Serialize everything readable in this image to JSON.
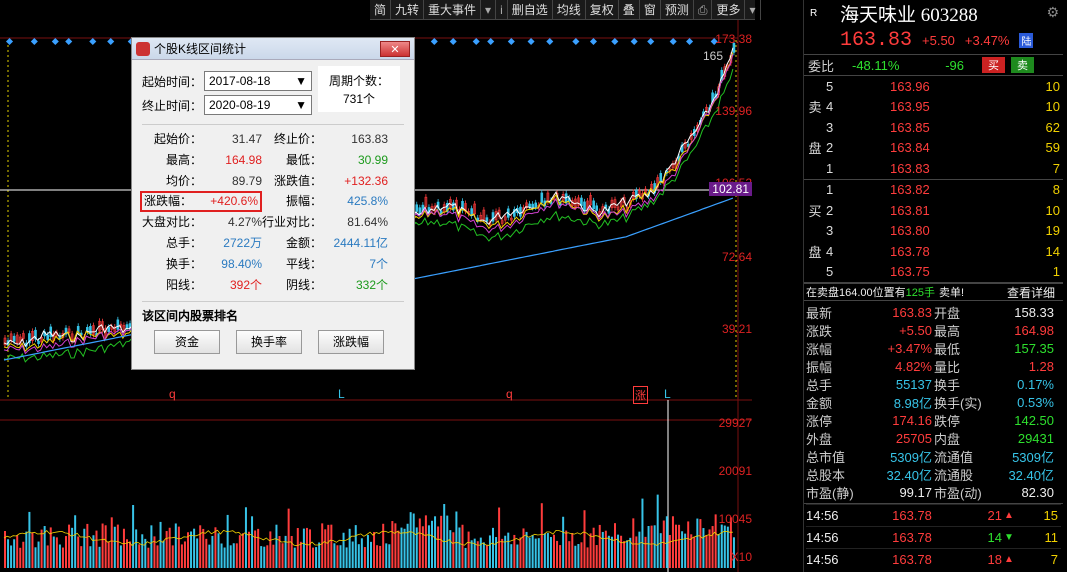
{
  "toolbar": {
    "items": [
      "简",
      "九转",
      "重大事件",
      "▾",
      "i",
      "删自选",
      "均线",
      "复权",
      "叠",
      "窗",
      "预测",
      "⎙",
      "更多",
      "▾"
    ]
  },
  "chart": {
    "price_axis": [
      "173.38",
      "139.96",
      "106.52",
      "72.64",
      "39.21"
    ],
    "current_price_tag": "102.81",
    "peak_label": "165",
    "volume_axis": [
      "29927",
      "20091",
      "10045",
      "X10"
    ],
    "markers": [
      "q",
      "L",
      "q",
      "涨",
      "L"
    ],
    "colors": {
      "up": "#ff3c3c",
      "down": "#37c4e8",
      "ma1": "#ffffff",
      "ma2": "#f0d000",
      "ma3": "#d040d0",
      "ma4": "#22c022",
      "ma5": "#3aa0ff"
    }
  },
  "dialog": {
    "title": "个股K线区间统计",
    "close_label": "✕",
    "start_label": "起始时间：",
    "start_value": "2017-08-18",
    "end_label": "终止时间：",
    "end_value": "2020-08-19",
    "period_label": "周期个数：",
    "period_value": "731个",
    "stats": {
      "start_price_label": "起始价：",
      "start_price": "31.47",
      "end_price_label": "终止价：",
      "end_price": "163.83",
      "high_label": "最高：",
      "high": "164.98",
      "low_label": "最低：",
      "low": "30.99",
      "avg_label": "均价：",
      "avg": "89.79",
      "change_label": "涨跌值：",
      "change": "+132.36",
      "pct_label": "涨跌幅：",
      "pct": "+420.6%",
      "amp_label": "振幅：",
      "amp": "425.8%",
      "mkt_label": "大盘对比：",
      "mkt": "4.27%",
      "ind_label": "行业对比：",
      "ind": "81.64%",
      "vol_label": "总手：",
      "vol": "2722万",
      "amt_label": "金额：",
      "amt": "2444.11亿",
      "turn_label": "换手：",
      "turn": "98.40%",
      "flat_label": "平线：",
      "flat": "7个",
      "yang_label": "阳线：",
      "yang": "392个",
      "yin_label": "阴线：",
      "yin": "332个"
    },
    "rank_title": "该区间内股票排名",
    "rank_buttons": [
      "资金",
      "换手率",
      "涨跌幅"
    ]
  },
  "quote": {
    "r_label": "R",
    "name": "海天味业 603288",
    "price": "163.83",
    "change": "+5.50",
    "pct": "+3.47%",
    "board_tag": "陆",
    "weibi_label": "委比",
    "weibi_pct": "-48.11%",
    "weibi_diff": "-96",
    "buy_btn": "买",
    "sell_btn": "卖",
    "sell_side_chars": [
      "卖",
      "",
      "盘",
      ""
    ],
    "buy_side_chars": [
      "",
      "买",
      "",
      "盘",
      ""
    ],
    "asks": [
      {
        "lvl": "5",
        "px": "163.96",
        "vol": "10"
      },
      {
        "lvl": "4",
        "px": "163.95",
        "vol": "10"
      },
      {
        "lvl": "3",
        "px": "163.85",
        "vol": "62"
      },
      {
        "lvl": "2",
        "px": "163.84",
        "vol": "59"
      },
      {
        "lvl": "1",
        "px": "163.83",
        "vol": "7"
      }
    ],
    "bids": [
      {
        "lvl": "1",
        "px": "163.82",
        "vol": "8"
      },
      {
        "lvl": "2",
        "px": "163.81",
        "vol": "10"
      },
      {
        "lvl": "3",
        "px": "163.80",
        "vol": "19"
      },
      {
        "lvl": "4",
        "px": "163.78",
        "vol": "14"
      },
      {
        "lvl": "5",
        "px": "163.75",
        "vol": "1"
      }
    ],
    "notice_pre": "在卖盘164.00位置有",
    "notice_qty": "125手",
    "notice_post": "卖单!",
    "notice_link": "查看详细",
    "stats": [
      {
        "l1": "最新",
        "v1": "163.83",
        "c1": "red",
        "l2": "开盘",
        "v2": "158.33",
        "c2": "white"
      },
      {
        "l1": "涨跌",
        "v1": "+5.50",
        "c1": "red",
        "l2": "最高",
        "v2": "164.98",
        "c2": "red"
      },
      {
        "l1": "涨幅",
        "v1": "+3.47%",
        "c1": "red",
        "l2": "最低",
        "v2": "157.35",
        "c2": "green"
      },
      {
        "l1": "振幅",
        "v1": "4.82%",
        "c1": "red",
        "l2": "量比",
        "v2": "1.28",
        "c2": "red"
      },
      {
        "l1": "总手",
        "v1": "55137",
        "c1": "cyan",
        "l2": "换手",
        "v2": "0.17%",
        "c2": "cyan"
      },
      {
        "l1": "金额",
        "v1": "8.98亿",
        "c1": "cyan",
        "l2": "换手(实)",
        "v2": "0.53%",
        "c2": "cyan"
      },
      {
        "l1": "涨停",
        "v1": "174.16",
        "c1": "red",
        "l2": "跌停",
        "v2": "142.50",
        "c2": "green"
      },
      {
        "l1": "外盘",
        "v1": "25705",
        "c1": "red",
        "l2": "内盘",
        "v2": "29431",
        "c2": "green"
      },
      {
        "l1": "总市值",
        "v1": "5309亿",
        "c1": "cyan",
        "l2": "流通值",
        "v2": "5309亿",
        "c2": "cyan"
      },
      {
        "l1": "总股本",
        "v1": "32.40亿",
        "c1": "cyan",
        "l2": "流通股",
        "v2": "32.40亿",
        "c2": "cyan"
      },
      {
        "l1": "市盈(静)",
        "v1": "99.17",
        "c1": "white",
        "l2": "市盈(动)",
        "v2": "82.30",
        "c2": "white"
      }
    ],
    "ticks": [
      {
        "time": "14:56",
        "px": "163.78",
        "vol": "21",
        "dir": "up",
        "n": "15"
      },
      {
        "time": "14:56",
        "px": "163.78",
        "vol": "14",
        "dir": "down",
        "n": "11"
      },
      {
        "time": "14:56",
        "px": "163.78",
        "vol": "18",
        "dir": "up",
        "n": "7"
      }
    ]
  }
}
